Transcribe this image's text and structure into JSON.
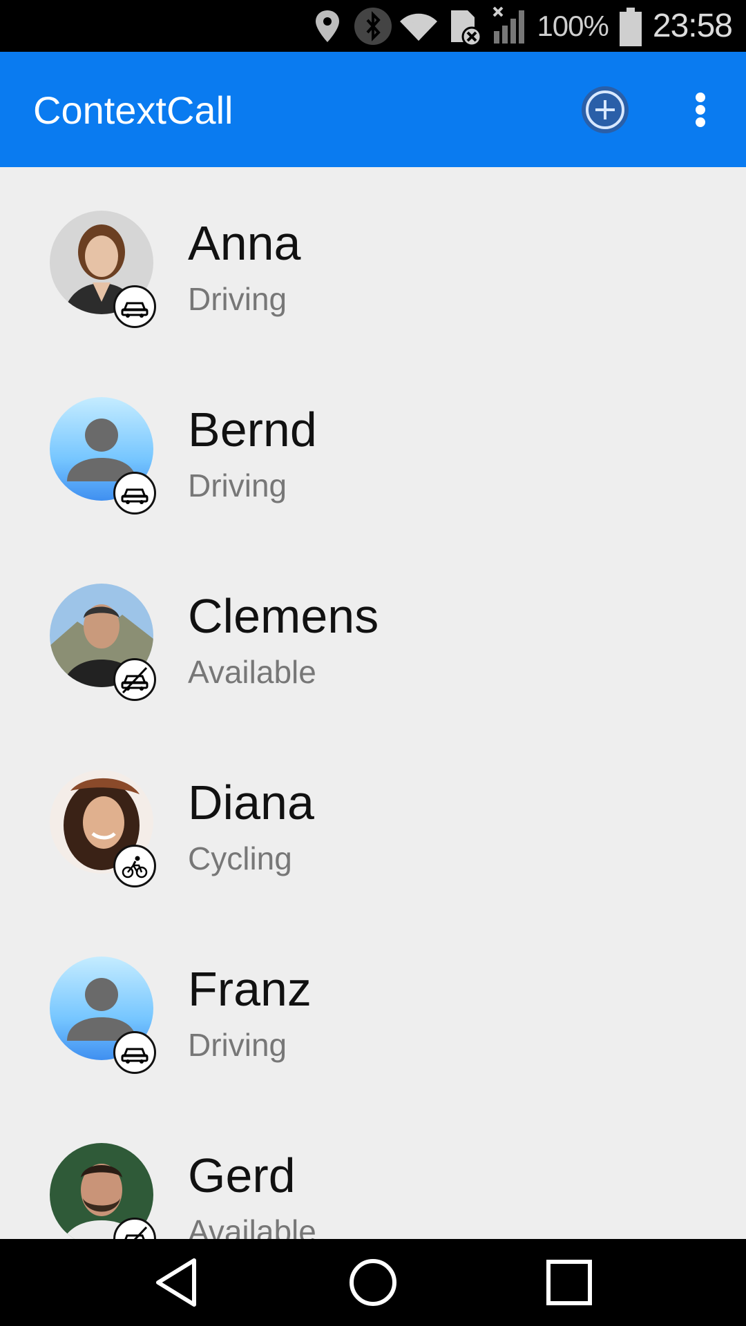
{
  "status_bar": {
    "battery_text": "100%",
    "time": "23:58"
  },
  "app_bar": {
    "title": "ContextCall",
    "background_color": "#0a7bf0"
  },
  "contacts": [
    {
      "name": "Anna",
      "status": "Driving",
      "avatar": "photo",
      "context_icon": "car-icon"
    },
    {
      "name": "Bernd",
      "status": "Driving",
      "avatar": "placeholder",
      "context_icon": "car-icon"
    },
    {
      "name": "Clemens",
      "status": "Available",
      "avatar": "photo",
      "context_icon": "car-crossed-icon"
    },
    {
      "name": "Diana",
      "status": "Cycling",
      "avatar": "photo",
      "context_icon": "bicycle-icon"
    },
    {
      "name": "Franz",
      "status": "Driving",
      "avatar": "placeholder",
      "context_icon": "car-icon"
    },
    {
      "name": "Gerd",
      "status": "Available",
      "avatar": "photo",
      "context_icon": "car-crossed-icon"
    }
  ]
}
